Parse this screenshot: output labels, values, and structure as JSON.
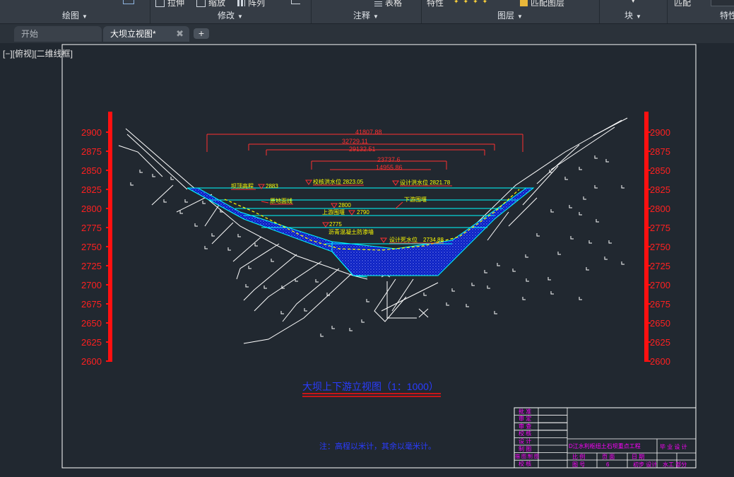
{
  "ribbon": {
    "panels": [
      {
        "title": "绘图",
        "buttons": []
      },
      {
        "title": "修改",
        "buttons": [
          "拉伸",
          "缩放",
          "阵列"
        ]
      },
      {
        "title": "注释",
        "buttons": [
          "表格"
        ]
      },
      {
        "title": "图层",
        "buttons": [
          "特性",
          "匹配图层"
        ]
      },
      {
        "title": "块",
        "buttons": []
      },
      {
        "title": "",
        "buttons": [
          "匹配"
        ]
      },
      {
        "title": "特性",
        "buttons": []
      }
    ]
  },
  "tabs": {
    "start": "开始",
    "active": "大坝立视图*",
    "add": "+"
  },
  "viewport_label": "[−][俯视][二维线框]",
  "drawing": {
    "elevation_labels": [
      "2900",
      "2875",
      "2850",
      "2825",
      "2800",
      "2775",
      "2750",
      "2725",
      "2700",
      "2675",
      "2650",
      "2625",
      "2600"
    ],
    "dimensions": [
      "41807.88",
      "32729.11",
      "29132.51",
      "23737.6",
      "14955.86"
    ],
    "annotations": {
      "crest": "坝顶高程",
      "crest_value": "2883",
      "check_flood": "校核洪水位 2823.05",
      "design_flood": "设计洪水位 2821.78",
      "original_ground": "原地面线",
      "downstream_cofferdam": "下游围堰",
      "el_2800": "2800",
      "upstream_cofferdam": "上游围堰",
      "el_2790": "2790",
      "el_2775": "2775",
      "asphalt_wall": "沥青混凝土防渗墙",
      "dead_level": "设计死水位",
      "dead_level_value": "2734.88"
    },
    "title": "大坝上下游立视图（1：1000）",
    "note": "注：高程以米计，其余以毫米计。",
    "title_block": {
      "rows": [
        "批 准",
        "审 定",
        "审 查",
        "校 核",
        "设 计",
        "制 图",
        "描 图 制 图",
        "校 核"
      ],
      "project": "D江水利枢纽土石坝重点工程",
      "design_type": "毕 业 设 计",
      "scale_label": "比 例",
      "page_label": "页 面",
      "date_label": "日 期",
      "drawing_no_label": "图 号",
      "sheet_value": "6",
      "stage": "初步 设计",
      "dept": "水工 部分"
    }
  },
  "colors": {
    "bg": "#212830",
    "elev": "#ff2020",
    "dim": "#ff3030",
    "anno": "#ffff00",
    "water": "#00ffff",
    "dam": "#0a1fbf",
    "frame": "#ffffff",
    "title": "#2a3cff",
    "block": "#ff00ff"
  }
}
